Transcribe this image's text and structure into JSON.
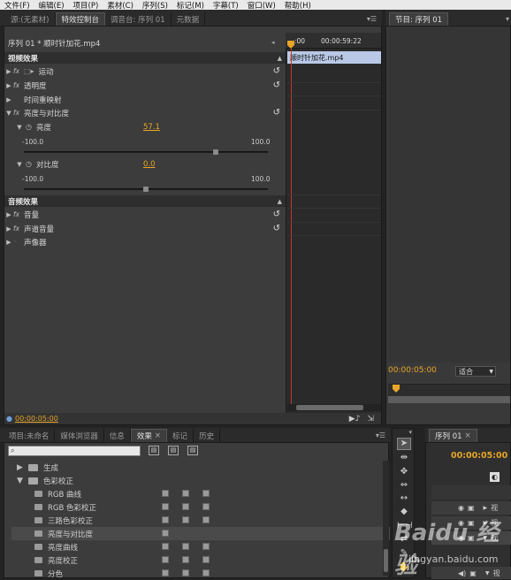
{
  "menu": [
    "文件(F)",
    "编辑(E)",
    "项目(P)",
    "素材(C)",
    "序列(S)",
    "标记(M)",
    "字幕(T)",
    "窗口(W)",
    "帮助(H)"
  ],
  "top_tabs": {
    "source": "源:(无素材)",
    "effect_controls": "特效控制台",
    "audio_mixer": "调音台: 序列 01",
    "metadata": "元数据"
  },
  "program_tab": "节目: 序列 01",
  "effect_controls": {
    "clip_label": "序列 01 * 顺时针加花.mp4",
    "ruler_start": ":00",
    "ruler_end": "00:00:59:22",
    "clip_name": "顺时针加花.mp4",
    "video_header": "视频效果",
    "motion": "运动",
    "opacity": "透明度",
    "time_remap": "时间重映射",
    "brightness_contrast": "亮度与对比度",
    "brightness": "亮度",
    "brightness_value": "57.1",
    "brightness_min": "-100.0",
    "brightness_max": "100.0",
    "brightness_level": 0.785,
    "contrast": "对比度",
    "contrast_value": "0.0",
    "contrast_min": "-100.0",
    "contrast_max": "100.0",
    "contrast_level": 0.5,
    "audio_header": "音频效果",
    "volume": "音量",
    "channel_volume": "声道音量",
    "panner": "声像器",
    "timecode": "00:00:05:00"
  },
  "program": {
    "timecode": "00:00:05:00",
    "fit": "适合"
  },
  "effects_panel": {
    "tabs": [
      "项目:未命名",
      "媒体浏览器",
      "信息",
      "效果",
      "标记",
      "历史"
    ],
    "items": [
      {
        "label": "生成",
        "type": "folder",
        "indent": 1,
        "open": false
      },
      {
        "label": "色彩校正",
        "type": "folder",
        "indent": 1,
        "open": true
      },
      {
        "label": "RGB 曲线",
        "type": "effect",
        "indent": 2
      },
      {
        "label": "RGB 色彩校正",
        "type": "effect",
        "indent": 2
      },
      {
        "label": "三路色彩校正",
        "type": "effect",
        "indent": 2
      },
      {
        "label": "亮度与对比度",
        "type": "effect",
        "indent": 2,
        "selected": true
      },
      {
        "label": "亮度曲线",
        "type": "effect",
        "indent": 2
      },
      {
        "label": "亮度校正",
        "type": "effect",
        "indent": 2
      },
      {
        "label": "分色",
        "type": "effect",
        "indent": 2
      }
    ]
  },
  "sequence_panel": {
    "tab": "序列 01",
    "timecode": "00:00:05:00",
    "track_label": "视"
  },
  "watermark": {
    "text": "Baidu 经验",
    "url": "jingyan.baidu.com"
  }
}
